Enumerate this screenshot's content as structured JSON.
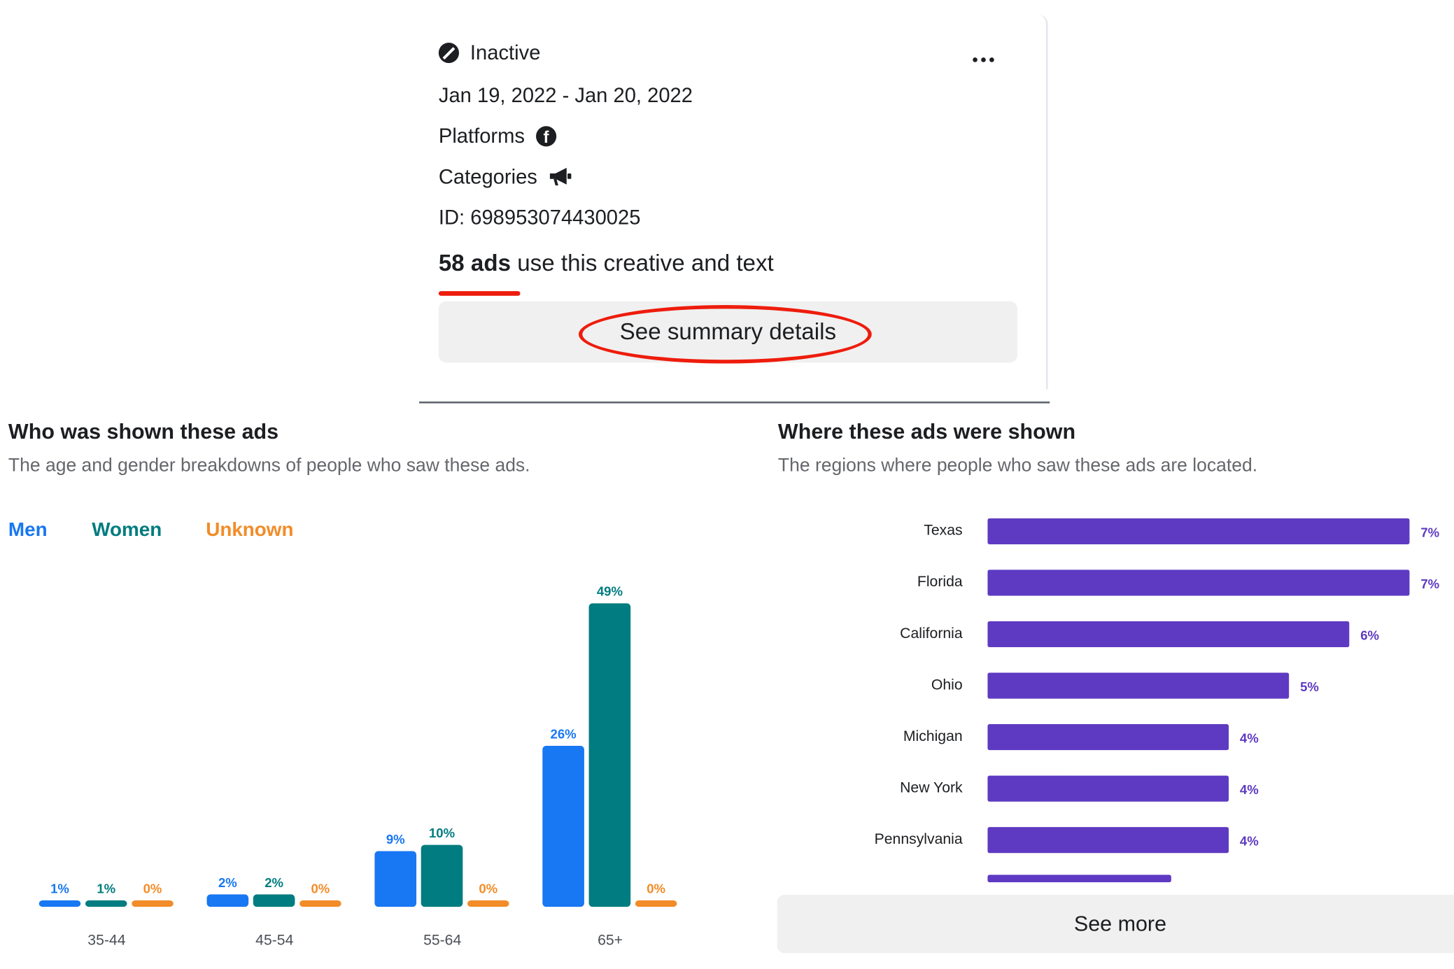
{
  "ad_card": {
    "status": "Inactive",
    "dates": "Jan 19, 2022 - Jan 20, 2022",
    "platforms_label": "Platforms",
    "categories_label": "Categories",
    "id_text": "ID: 698953074430025",
    "ads_count": "58 ads",
    "ads_text": " use this creative and text",
    "summary_button": "See summary details",
    "annotation_color": "#ee1c0c",
    "icons": [
      "status-inactive-icon",
      "more-options-icon",
      "facebook-icon",
      "megaphone-icon"
    ]
  },
  "audience": {
    "title": "Who was shown these ads",
    "subtitle": "The age and gender breakdowns of people who saw these ads.",
    "legend": [
      {
        "label": "Men",
        "color": "#1877f2"
      },
      {
        "label": "Women",
        "color": "#017c80"
      },
      {
        "label": "Unknown",
        "color": "#f28c28"
      }
    ]
  },
  "regions": {
    "title": "Where these ads were shown",
    "subtitle": "The regions where people who saw these ads are located.",
    "see_more": "See more"
  },
  "chart_data": [
    {
      "type": "bar",
      "categories": [
        "35-44",
        "45-54",
        "55-64",
        "65+"
      ],
      "series": [
        {
          "name": "Men",
          "color": "#1877f2",
          "values": [
            1,
            2,
            9,
            26
          ],
          "labels": [
            "1%",
            "2%",
            "9%",
            "26%"
          ]
        },
        {
          "name": "Women",
          "color": "#017c80",
          "values": [
            1,
            2,
            10,
            49
          ],
          "labels": [
            "1%",
            "2%",
            "10%",
            "49%"
          ]
        },
        {
          "name": "Unknown",
          "color": "#f28c28",
          "values": [
            0,
            0,
            0,
            0
          ],
          "labels": [
            "0%",
            "0%",
            "0%",
            "0%"
          ]
        }
      ],
      "ylim": [
        0,
        50
      ],
      "legend_position": "top-left"
    },
    {
      "type": "bar",
      "orientation": "horizontal",
      "color": "#5e3ac2",
      "categories": [
        "Texas",
        "Florida",
        "California",
        "Ohio",
        "Michigan",
        "New York",
        "Pennsylvania"
      ],
      "values": [
        7,
        7,
        6,
        5,
        4,
        4,
        4
      ],
      "labels": [
        "7%",
        "7%",
        "6%",
        "5%",
        "4%",
        "4%",
        "4%"
      ],
      "xlim": [
        0,
        7
      ]
    }
  ]
}
